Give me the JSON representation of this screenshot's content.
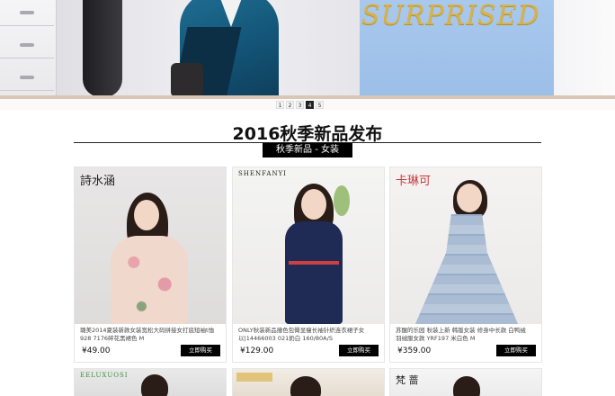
{
  "banner": {
    "slogan": "SURPRISED",
    "pager": [
      "1",
      "2",
      "3",
      "4",
      "5"
    ],
    "active_page": "4",
    "colors": {
      "sky": "#a9c8ed",
      "gold": "#d7b24a",
      "teal_top": "#1f6f93"
    }
  },
  "section": {
    "title": "2016秋季新品发布",
    "subtitle": "秋季新品 - 女装"
  },
  "products": [
    {
      "brand": "詩水涵",
      "caption": "璐美2014夏装新款女装宽松大码拼接女打底短袖t恤928 7176碎花黑裙色 M",
      "price": "¥49.00",
      "buy_label": "立即购买"
    },
    {
      "brand": "SHENFANYI",
      "caption": "ONLY秋装新品撞色包臀显瘦长袖针织连衣裙子女 以|14466003 021奶白 160/80A/S",
      "price": "¥129.00",
      "buy_label": "立即购买"
    },
    {
      "brand": "卡琳可",
      "caption": "苏醒的乐园 秋装上新 韩版女装 修身中长款 白鸭绒 羽绒服女款 YRF197 米白色 M",
      "price": "¥359.00",
      "buy_label": "立即购买"
    }
  ],
  "partial_row": [
    {
      "brand": "EELUXUOSI"
    },
    {
      "brand": ""
    },
    {
      "brand": "梵 蔷"
    }
  ]
}
